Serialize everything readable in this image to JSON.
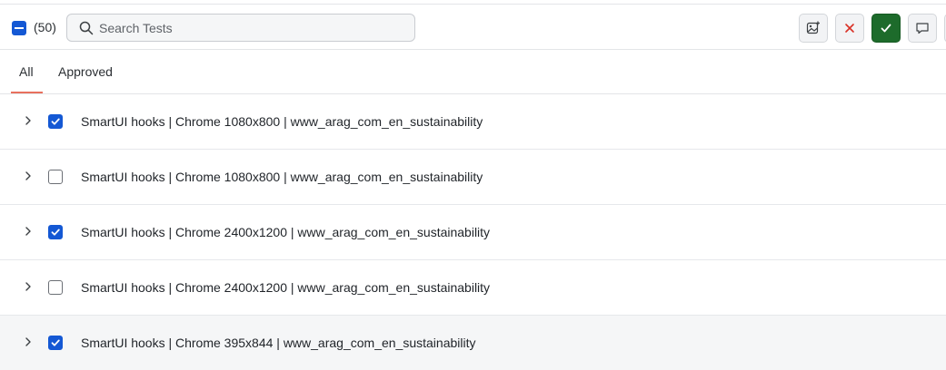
{
  "toolbar": {
    "count_label": "(50)",
    "search_placeholder": "Search Tests",
    "colors": {
      "checkbox": "#1458d4",
      "approve": "#1d6b2b",
      "reject": "#d93025",
      "tab_underline": "#e8705e"
    }
  },
  "tabs": [
    {
      "label": "All",
      "active": true
    },
    {
      "label": "Approved",
      "active": false
    }
  ],
  "rows": [
    {
      "label": "SmartUI hooks | Chrome 1080x800 | www_arag_com_en_sustainability",
      "checked": true
    },
    {
      "label": "SmartUI hooks | Chrome 1080x800 | www_arag_com_en_sustainability",
      "checked": false
    },
    {
      "label": "SmartUI hooks | Chrome 2400x1200 | www_arag_com_en_sustainability",
      "checked": true
    },
    {
      "label": "SmartUI hooks | Chrome 2400x1200 | www_arag_com_en_sustainability",
      "checked": false
    },
    {
      "label": "SmartUI hooks | Chrome 395x844 | www_arag_com_en_sustainability",
      "checked": true
    }
  ],
  "icons": [
    "select-all-checkbox-icon",
    "search-icon",
    "image-add-icon",
    "close-icon",
    "check-icon",
    "comment-icon",
    "chevron-right-icon"
  ]
}
